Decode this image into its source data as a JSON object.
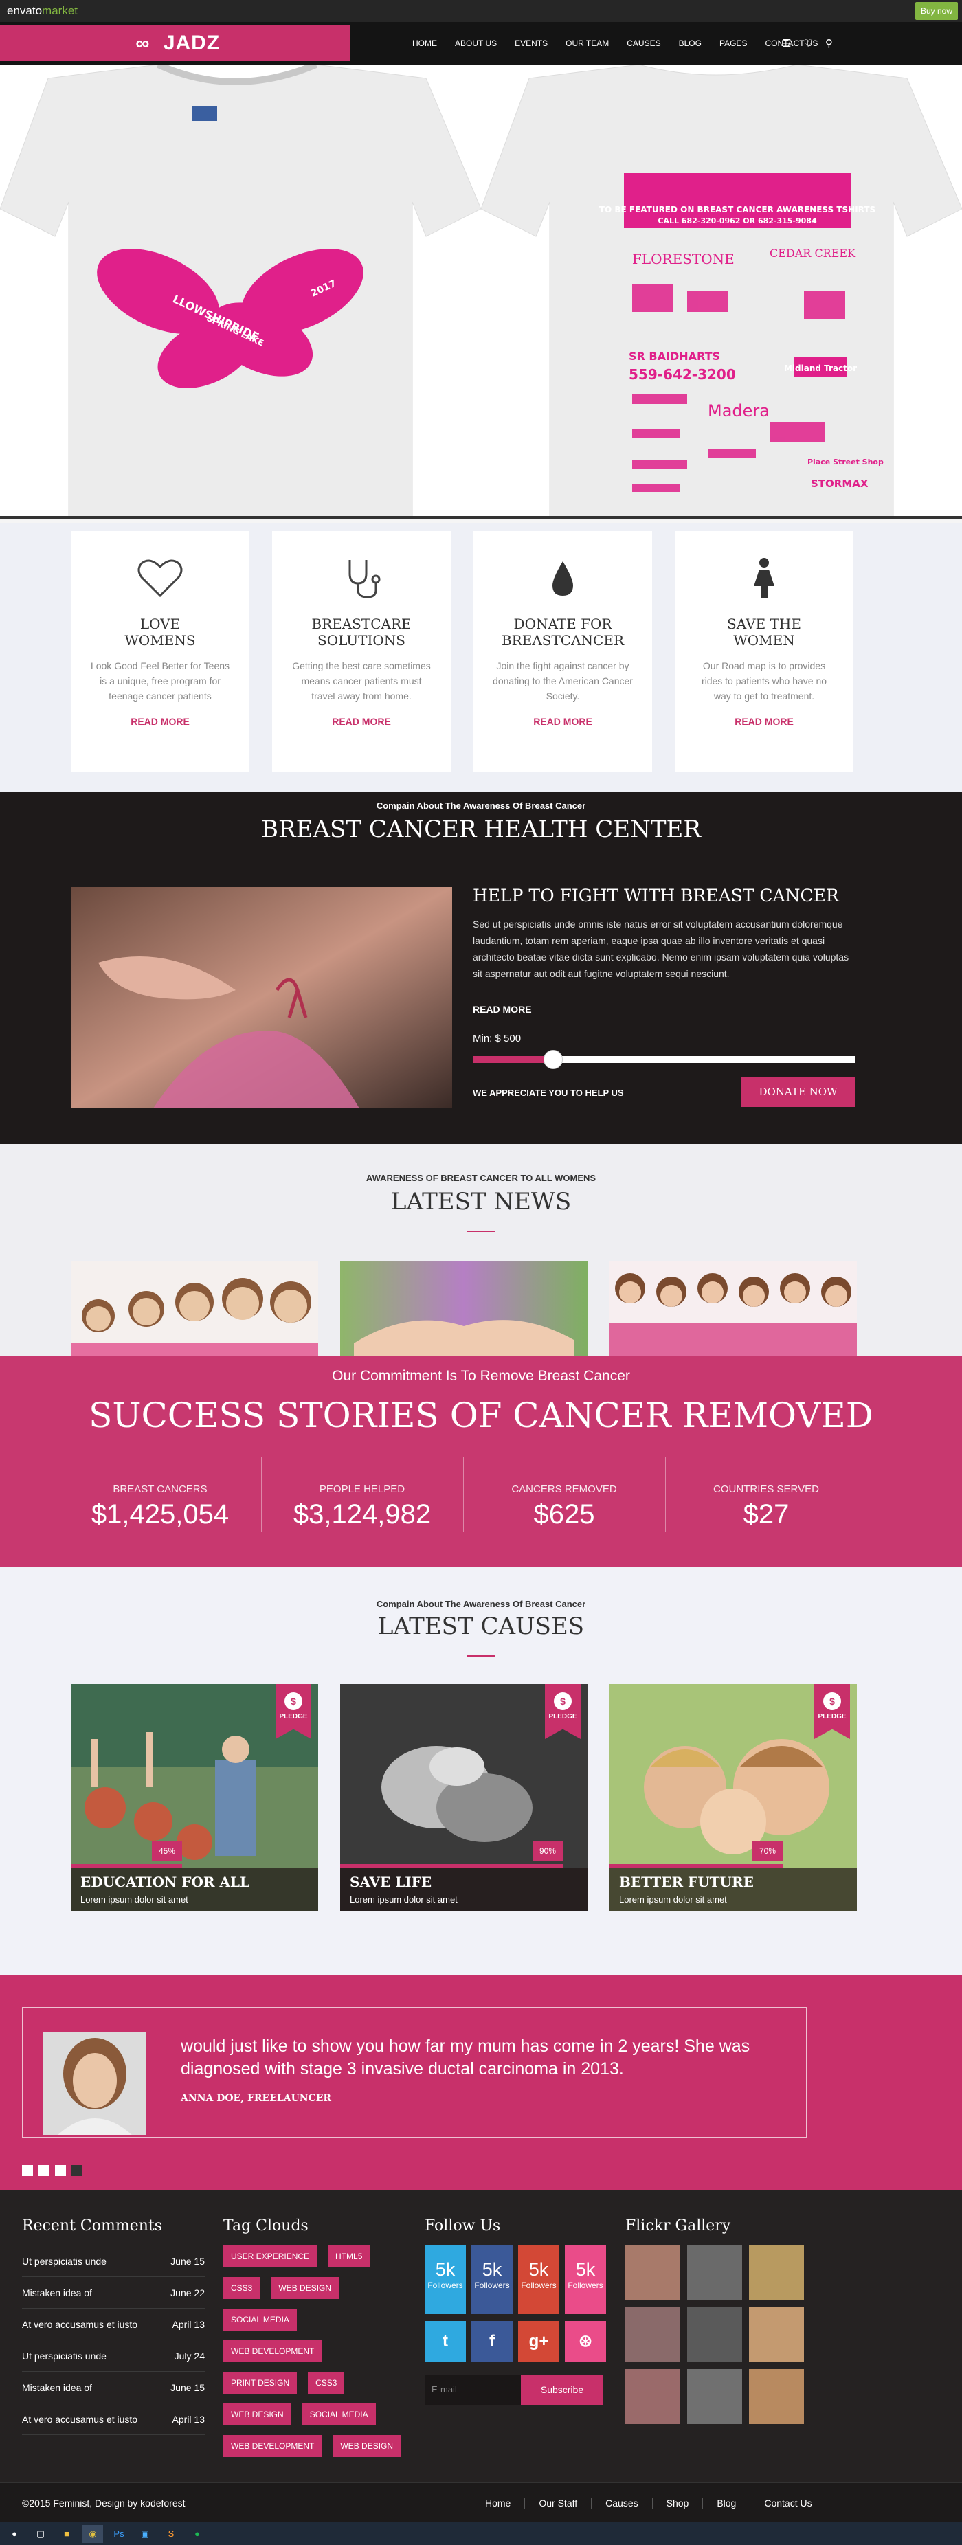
{
  "envato": {
    "logo_a": "envato",
    "logo_b": "market",
    "buy": "Buy now"
  },
  "nav": {
    "brand": "JADZ",
    "items": [
      "HOME",
      "ABOUT US",
      "EVENTS",
      "OUR TEAM",
      "CAUSES",
      "BLOG",
      "PAGES",
      "CONTACT US"
    ]
  },
  "hero": {
    "front_text": [
      "LLOWSHIPRIDE",
      "SPRING LAKE",
      "2017"
    ],
    "back": {
      "banner_l1": "TO BE FEATURED ON BREAST CANCER AWARENESS TSHIRTS",
      "banner_l2": "CALL 682-320-0962 OR 682-315-9084",
      "sponsors": [
        "FLORESTONE",
        "CEDAR CREEK",
        "SR BAIDHARTS",
        "Madera",
        "Midland Tractor",
        "Place Street Shop",
        "STORMAX",
        "559-642-3200"
      ]
    }
  },
  "features": [
    {
      "title_l1": "LOVE",
      "title_l2": "WOMENS",
      "text": "Look Good Feel Better for Teens is a unique, free program for teenage cancer patients",
      "link": "READ MORE",
      "icon": "heart-icon"
    },
    {
      "title_l1": "BREASTCARE",
      "title_l2": "SOLUTIONS",
      "text": "Getting the best care sometimes means cancer patients must travel away from home.",
      "link": "READ MORE",
      "icon": "stethoscope-icon"
    },
    {
      "title_l1": "DONATE FOR",
      "title_l2": "BREASTCANCER",
      "text": "Join the fight against cancer by donating to the American Cancer Society.",
      "link": "READ MORE",
      "icon": "drop-icon"
    },
    {
      "title_l1": "SAVE THE",
      "title_l2": "WOMEN",
      "text": "Our Road map is to provides rides to patients who have no way to get to treatment.",
      "link": "READ MORE",
      "icon": "woman-icon"
    }
  ],
  "health": {
    "kicker": "Compain About The Awareness Of Breast Cancer",
    "title": "BREAST CANCER HEALTH CENTER",
    "heading": "HELP TO FIGHT WITH BREAST CANCER",
    "desc": "Sed ut perspiciatis unde omnis iste natus error sit voluptatem accusantium doloremque laudantium, totam rem aperiam, eaque ipsa quae ab illo inventore veritatis et quasi architecto beatae vitae dicta sunt explicabo. Nemo enim ipsam voluptatem quia voluptas sit aspernatur aut odit aut fugitne voluptatem sequi nesciunt.",
    "more": "READ MORE",
    "min": "Min: $ 500",
    "slider_fraction": 0.21,
    "appreciate": "WE APPRECIATE YOU TO HELP US",
    "donate": "DONATE NOW"
  },
  "news": {
    "kicker": "AWARENESS OF BREAST CANCER TO ALL WOMENS",
    "title": "LATEST NEWS"
  },
  "stories": {
    "sub": "Our Commitment Is To Remove Breast Cancer",
    "title": "SUCCESS STORIES OF CANCER REMOVED",
    "stats": [
      {
        "label": "BREAST CANCERS",
        "value": "$1,425,054"
      },
      {
        "label": "PEOPLE HELPED",
        "value": "$3,124,982"
      },
      {
        "label": "CANCERS REMOVED",
        "value": "$625"
      },
      {
        "label": "COUNTRIES SERVED",
        "value": "$27"
      }
    ]
  },
  "causes": {
    "kicker": "Compain About The Awareness Of Breast Cancer",
    "title": "LATEST CAUSES",
    "pledge": "PLEDGE",
    "pledge_symbol": "$",
    "items": [
      {
        "title": "EDUCATION FOR ALL",
        "sub": "Lorem ipsum dolor sit amet",
        "pct": "45%",
        "progress": 0.45
      },
      {
        "title": "SAVE LIFE",
        "sub": "Lorem ipsum dolor sit amet",
        "pct": "90%",
        "progress": 0.9
      },
      {
        "title": "BETTER FUTURE",
        "sub": "Lorem ipsum dolor sit amet",
        "pct": "70%",
        "progress": 0.7
      }
    ]
  },
  "testimonial": {
    "quote": "would just like to show you how far my mum has come in 2 years! She was diagnosed with stage 3 invasive ductal carcinoma in 2013.",
    "author": "ANNA DOE, FREELAUNCER",
    "active_dot": 4
  },
  "footer": {
    "comments_title": "Recent Comments",
    "comments": [
      {
        "t": "Ut perspiciatis unde",
        "d": "June 15"
      },
      {
        "t": "Mistaken idea of",
        "d": "June 22"
      },
      {
        "t": "At vero accusamus et iusto",
        "d": "April 13"
      },
      {
        "t": "Ut perspiciatis unde",
        "d": "July 24"
      },
      {
        "t": "Mistaken idea of",
        "d": "June 15"
      },
      {
        "t": "At vero accusamus et iusto",
        "d": "April 13"
      }
    ],
    "tags_title": "Tag Clouds",
    "tags": [
      "USER EXPERIENCE",
      "HTML5",
      "CSS3",
      "WEB DESIGN",
      "SOCIAL MEDIA",
      "WEB DEVELOPMENT",
      "PRINT DESIGN",
      "CSS3",
      "WEB DESIGN",
      "SOCIAL MEDIA",
      "WEB DEVELOPMENT",
      "WEB DESIGN"
    ],
    "follow_title": "Follow Us",
    "followers": [
      {
        "n": "5k",
        "t": "Followers",
        "color": "#2fa9e0"
      },
      {
        "n": "5k",
        "t": "Followers",
        "color": "#3b5998"
      },
      {
        "n": "5k",
        "t": "Followers",
        "color": "#d34836"
      },
      {
        "n": "5k",
        "t": "Followers",
        "color": "#ea4c89"
      }
    ],
    "social": [
      {
        "g": "t",
        "color": "#2fa9e0"
      },
      {
        "g": "f",
        "color": "#3b5998"
      },
      {
        "g": "g+",
        "color": "#d34836"
      },
      {
        "g": "⊛",
        "color": "#ea4c89"
      }
    ],
    "email_ph": "E-mail",
    "subscribe": "Subscribe",
    "flickr_title": "Flickr Gallery"
  },
  "copy": {
    "text": "©2015 Feminist, Design by kodeforest",
    "links": [
      "Home",
      "Our Staff",
      "Causes",
      "Shop",
      "Blog",
      "Contact Us"
    ]
  },
  "colors": {
    "accent": "#c8306a",
    "dark": "#1e1a1a"
  }
}
